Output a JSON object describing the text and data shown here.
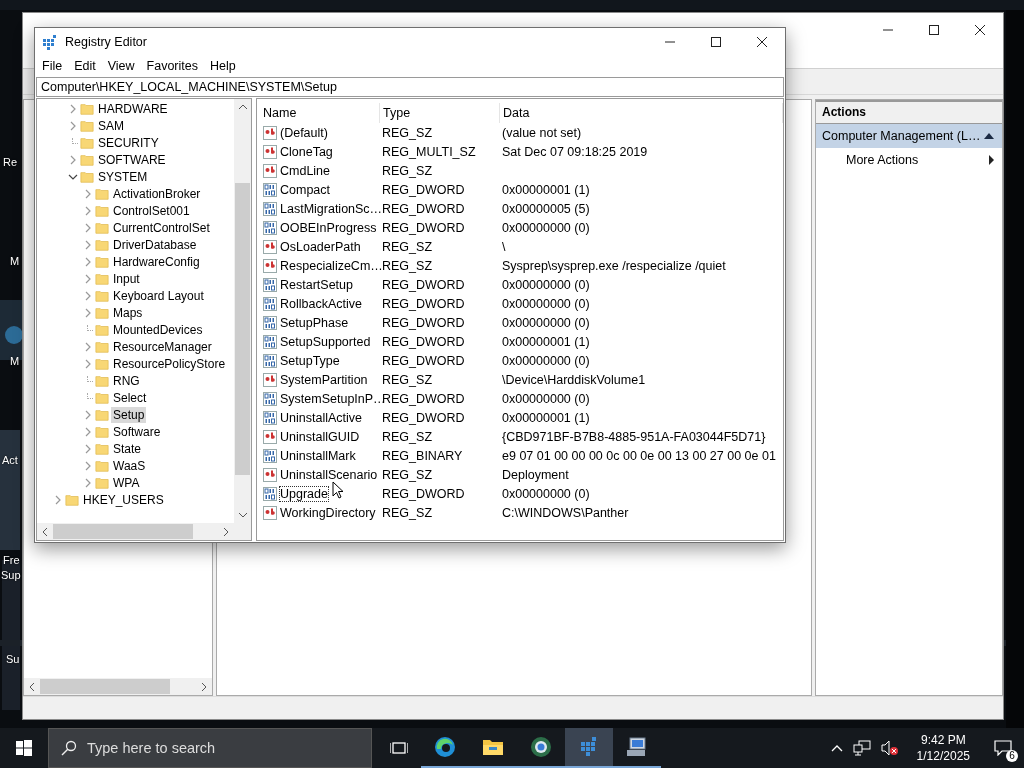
{
  "desktop_icons": [
    {
      "label": "Re"
    },
    {
      "label": "M"
    },
    {
      "label": "M"
    },
    {
      "label": "Act"
    },
    {
      "label": "Fre"
    },
    {
      "label": "Sup"
    },
    {
      "label": "Su"
    }
  ],
  "computer_management": {
    "actions_pane": {
      "header": "Actions",
      "items": [
        {
          "label": "Computer Management (L…",
          "kind": "section"
        },
        {
          "label": "More Actions",
          "kind": "submenu"
        }
      ]
    }
  },
  "registry_editor": {
    "title": "Registry Editor",
    "menu": [
      "File",
      "Edit",
      "View",
      "Favorites",
      "Help"
    ],
    "address": "Computer\\HKEY_LOCAL_MACHINE\\SYSTEM\\Setup",
    "tree": [
      {
        "children": [
          {
            "kind": "branch",
            "label": "HARDWARE",
            "expanded": false,
            "selected": false
          },
          {
            "kind": "branch",
            "label": "SAM",
            "expanded": false,
            "selected": false
          },
          {
            "kind": "leaf",
            "label": "SECURITY",
            "selected": false
          },
          {
            "kind": "branch",
            "label": "SOFTWARE",
            "expanded": false,
            "selected": false
          },
          {
            "kind": "branch",
            "label": "SYSTEM",
            "expanded": true,
            "selected": false,
            "children": [
              {
                "kind": "branch",
                "label": "ActivationBroker",
                "expanded": false,
                "selected": false
              },
              {
                "kind": "branch",
                "label": "ControlSet001",
                "expanded": false,
                "selected": false
              },
              {
                "kind": "branch",
                "label": "CurrentControlSet",
                "expanded": false,
                "selected": false
              },
              {
                "kind": "branch",
                "label": "DriverDatabase",
                "expanded": false,
                "selected": false
              },
              {
                "kind": "branch",
                "label": "HardwareConfig",
                "expanded": false,
                "selected": false
              },
              {
                "kind": "branch",
                "label": "Input",
                "expanded": false,
                "selected": false
              },
              {
                "kind": "branch",
                "label": "Keyboard Layout",
                "expanded": false,
                "selected": false
              },
              {
                "kind": "branch",
                "label": "Maps",
                "expanded": false,
                "selected": false
              },
              {
                "kind": "leaf",
                "label": "MountedDevices",
                "selected": false
              },
              {
                "kind": "branch",
                "label": "ResourceManager",
                "expanded": false,
                "selected": false
              },
              {
                "kind": "branch",
                "label": "ResourcePolicyStore",
                "expanded": false,
                "selected": false
              },
              {
                "kind": "leaf",
                "label": "RNG",
                "selected": false
              },
              {
                "kind": "leaf",
                "label": "Select",
                "selected": false
              },
              {
                "kind": "branch",
                "label": "Setup",
                "expanded": false,
                "selected": true
              },
              {
                "kind": "branch",
                "label": "Software",
                "expanded": false,
                "selected": false
              },
              {
                "kind": "branch",
                "label": "State",
                "expanded": false,
                "selected": false
              },
              {
                "kind": "branch",
                "label": "WaaS",
                "expanded": false,
                "selected": false
              },
              {
                "kind": "branch",
                "label": "WPA",
                "expanded": false,
                "selected": false
              }
            ]
          }
        ]
      },
      {
        "kind": "branch",
        "label": "HKEY_USERS",
        "expanded": false,
        "selected": false
      }
    ],
    "columns": [
      "Name",
      "Type",
      "Data"
    ],
    "values": [
      {
        "kind": "string",
        "name": "(Default)",
        "type": "REG_SZ",
        "data": "(value not set)",
        "focused": false
      },
      {
        "kind": "string",
        "name": "CloneTag",
        "type": "REG_MULTI_SZ",
        "data": "Sat Dec 07 09:18:25 2019",
        "focused": false
      },
      {
        "kind": "string",
        "name": "CmdLine",
        "type": "REG_SZ",
        "focused": false
      },
      {
        "kind": "binary",
        "name": "Compact",
        "type": "REG_DWORD",
        "data": "0x00000001 (1)",
        "focused": false
      },
      {
        "kind": "binary",
        "name": "LastMigrationSc…",
        "type": "REG_DWORD",
        "data": "0x00000005 (5)",
        "focused": false
      },
      {
        "kind": "binary",
        "name": "OOBEInProgress",
        "type": "REG_DWORD",
        "data": "0x00000000 (0)",
        "focused": false
      },
      {
        "kind": "string",
        "name": "OsLoaderPath",
        "type": "REG_SZ",
        "data": "\\",
        "focused": false
      },
      {
        "kind": "string",
        "name": "RespecializeCm…",
        "type": "REG_SZ",
        "data": "Sysprep\\sysprep.exe /respecialize /quiet",
        "focused": false
      },
      {
        "kind": "binary",
        "name": "RestartSetup",
        "type": "REG_DWORD",
        "data": "0x00000000 (0)",
        "focused": false
      },
      {
        "kind": "binary",
        "name": "RollbackActive",
        "type": "REG_DWORD",
        "data": "0x00000000 (0)",
        "focused": false
      },
      {
        "kind": "binary",
        "name": "SetupPhase",
        "type": "REG_DWORD",
        "data": "0x00000000 (0)",
        "focused": false
      },
      {
        "kind": "binary",
        "name": "SetupSupported",
        "type": "REG_DWORD",
        "data": "0x00000001 (1)",
        "focused": false
      },
      {
        "kind": "binary",
        "name": "SetupType",
        "type": "REG_DWORD",
        "data": "0x00000000 (0)",
        "focused": false
      },
      {
        "kind": "string",
        "name": "SystemPartition",
        "type": "REG_SZ",
        "data": "\\Device\\HarddiskVolume1",
        "focused": false
      },
      {
        "kind": "binary",
        "name": "SystemSetupInP…",
        "type": "REG_DWORD",
        "data": "0x00000000 (0)",
        "focused": false
      },
      {
        "kind": "binary",
        "name": "UninstallActive",
        "type": "REG_DWORD",
        "data": "0x00000001 (1)",
        "focused": false
      },
      {
        "kind": "string",
        "name": "UninstallGUID",
        "type": "REG_SZ",
        "data": "{CBD971BF-B7B8-4885-951A-FA03044F5D71}",
        "focused": false
      },
      {
        "kind": "binary",
        "name": "UninstallMark",
        "type": "REG_BINARY",
        "data": "e9 07 01 00 00 00 0c 00 0e 00 13 00 27 00 0e 01",
        "focused": false
      },
      {
        "kind": "string",
        "name": "UninstallScenario",
        "type": "REG_SZ",
        "data": "Deployment",
        "focused": false
      },
      {
        "kind": "binary",
        "name": "Upgrade",
        "type": "REG_DWORD",
        "data": "0x00000000 (0)",
        "focused": true
      },
      {
        "kind": "string",
        "name": "WorkingDirectory",
        "type": "REG_SZ",
        "data": "C:\\WINDOWS\\Panther",
        "focused": false
      }
    ]
  },
  "taskbar": {
    "search": {
      "placeholder": "Type here to search"
    },
    "apps": [
      {
        "kind": "browser",
        "active": false
      },
      {
        "kind": "folder",
        "active": false
      },
      {
        "kind": "globe",
        "active": false
      },
      {
        "kind": "registry",
        "active": true
      },
      {
        "kind": "computer",
        "active": false
      }
    ],
    "clock": {
      "time": "9:42 PM",
      "date": "1/12/2025"
    },
    "notifications": {
      "count": "6"
    }
  }
}
